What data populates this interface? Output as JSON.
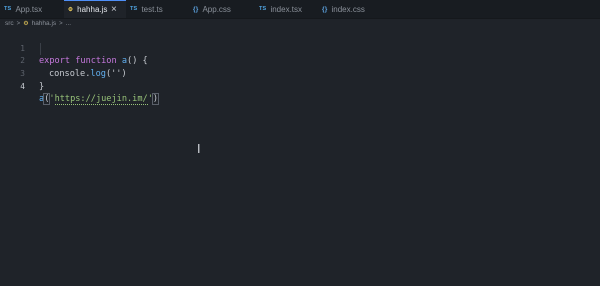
{
  "tabs": [
    {
      "icon": "TS",
      "icon_type": "ts",
      "label": "App.tsx",
      "active": false
    },
    {
      "icon": "⚙",
      "icon_type": "js",
      "label": "hahha.js",
      "active": true
    },
    {
      "icon": "TS",
      "icon_type": "ts",
      "label": "test.ts",
      "active": false
    },
    {
      "icon": "{}",
      "icon_type": "css",
      "label": "App.css",
      "active": false
    },
    {
      "icon": "TS",
      "icon_type": "ts",
      "label": "index.tsx",
      "active": false
    },
    {
      "icon": "{}",
      "icon_type": "css",
      "label": "index.css",
      "active": false
    }
  ],
  "close_glyph": "×",
  "breadcrumb": {
    "folder": "src",
    "sep": ">",
    "file_icon": "⚙",
    "file": "hahha.js",
    "ellipsis": "..."
  },
  "editor": {
    "line_numbers": [
      "1",
      "2",
      "3",
      "4"
    ],
    "line1": {
      "kw1": "export",
      "kw2": "function",
      "name": "a",
      "rest": "() {"
    },
    "line2": {
      "obj": "console.",
      "method": "log",
      "args": "('')"
    },
    "line3": {
      "text": "}"
    },
    "line4": {
      "fn": "a",
      "open": "(",
      "q1": "'",
      "url": "https://juejin.im/",
      "q2": "'",
      "close": ")"
    }
  },
  "cursor_glyph": "I",
  "colors": {
    "background": "#1f2329",
    "tabbar": "#181c21",
    "keyword": "#c678dd",
    "function": "#61afef",
    "string": "#98c379",
    "text": "#c8ccd2"
  }
}
